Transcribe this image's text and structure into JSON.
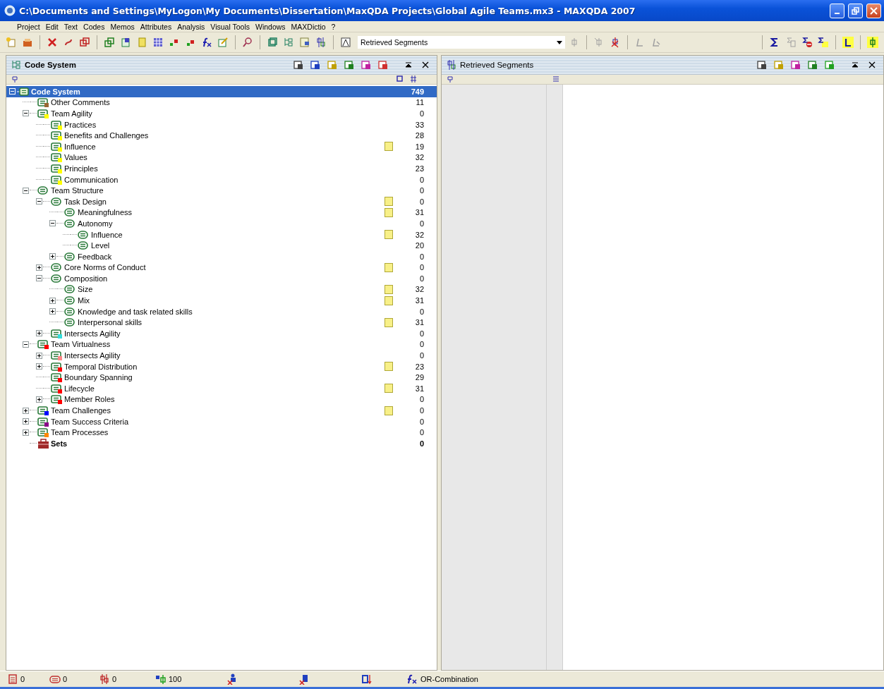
{
  "window": {
    "title": "C:\\Documents and Settings\\MyLogon\\My Documents\\Dissertation\\MaxQDA Projects\\Global Agile Teams.mx3 - MAXQDA 2007"
  },
  "menu": [
    "Project",
    "Edit",
    "Text",
    "Codes",
    "Memos",
    "Attributes",
    "Analysis",
    "Visual Tools",
    "Windows",
    "MAXDictio",
    "?"
  ],
  "toolbar": {
    "combo_value": "Retrieved Segments"
  },
  "code_panel": {
    "title": "Code System",
    "root": {
      "label": "Code System",
      "count": "749",
      "selected": true,
      "kind": "branch",
      "expanded": true
    },
    "codes": [
      {
        "label": "Other Comments",
        "count": "11",
        "memo": false,
        "kind": "leaf",
        "color": "#996633"
      },
      {
        "label": "Team Agility",
        "count": "0",
        "memo": false,
        "kind": "branch",
        "expanded": true,
        "color": "#ffff00",
        "children": [
          {
            "label": "Practices",
            "count": "33",
            "memo": false,
            "kind": "leaf",
            "color": "#ffff00"
          },
          {
            "label": "Benefits and Challenges",
            "count": "28",
            "memo": false,
            "kind": "leaf",
            "color": "#ffff00"
          },
          {
            "label": "Influence",
            "count": "19",
            "memo": true,
            "kind": "leaf",
            "color": "#ffff00"
          },
          {
            "label": "Values",
            "count": "32",
            "memo": false,
            "kind": "leaf",
            "color": "#ffff00"
          },
          {
            "label": "Principles",
            "count": "23",
            "memo": false,
            "kind": "leaf",
            "color": "#ffff00"
          },
          {
            "label": "Communication",
            "count": "0",
            "memo": false,
            "kind": "leaf",
            "color": "#ffff00"
          }
        ]
      },
      {
        "label": "Team Structure",
        "count": "0",
        "memo": false,
        "kind": "branch",
        "expanded": true,
        "children": [
          {
            "label": "Task Design",
            "count": "0",
            "memo": true,
            "kind": "branch",
            "expanded": true,
            "children": [
              {
                "label": "Meaningfulness",
                "count": "31",
                "memo": true,
                "kind": "leaf"
              },
              {
                "label": "Autonomy",
                "count": "0",
                "memo": false,
                "kind": "branch",
                "expanded": true,
                "children": [
                  {
                    "label": "Influence",
                    "count": "32",
                    "memo": true,
                    "kind": "leaf"
                  },
                  {
                    "label": "Level",
                    "count": "20",
                    "memo": false,
                    "kind": "leaf"
                  }
                ]
              },
              {
                "label": "Feedback",
                "count": "0",
                "memo": false,
                "kind": "branch",
                "expanded": false
              }
            ]
          },
          {
            "label": "Core Norms of Conduct",
            "count": "0",
            "memo": true,
            "kind": "branch",
            "expanded": false
          },
          {
            "label": "Composition",
            "count": "0",
            "memo": false,
            "kind": "branch",
            "expanded": true,
            "children": [
              {
                "label": "Size",
                "count": "32",
                "memo": true,
                "kind": "leaf"
              },
              {
                "label": "Mix",
                "count": "31",
                "memo": true,
                "kind": "branch",
                "expanded": false
              },
              {
                "label": "Knowledge and task related skills",
                "count": "0",
                "memo": false,
                "kind": "branch",
                "expanded": false
              },
              {
                "label": "Interpersonal skills",
                "count": "31",
                "memo": true,
                "kind": "leaf"
              }
            ]
          },
          {
            "label": "Intersects Agility",
            "count": "0",
            "memo": false,
            "kind": "branch",
            "expanded": false,
            "color": "#33dddd"
          }
        ]
      },
      {
        "label": "Team Virtualness",
        "count": "0",
        "memo": false,
        "kind": "branch",
        "expanded": true,
        "color": "#ff0000",
        "children": [
          {
            "label": "Intersects Agility",
            "count": "0",
            "memo": false,
            "kind": "branch",
            "expanded": false,
            "color": "#ff8888"
          },
          {
            "label": "Temporal Distribution",
            "count": "23",
            "memo": true,
            "kind": "branch",
            "expanded": false,
            "color": "#ff0000"
          },
          {
            "label": "Boundary Spanning",
            "count": "29",
            "memo": false,
            "kind": "leaf",
            "color": "#ff0000"
          },
          {
            "label": "Lifecycle",
            "count": "31",
            "memo": true,
            "kind": "leaf",
            "color": "#ff0000"
          },
          {
            "label": "Member Roles",
            "count": "0",
            "memo": false,
            "kind": "branch",
            "expanded": false,
            "color": "#ff0000"
          }
        ]
      },
      {
        "label": "Team Challenges",
        "count": "0",
        "memo": true,
        "kind": "branch",
        "expanded": false,
        "color": "#0000ff"
      },
      {
        "label": "Team Success Criteria",
        "count": "0",
        "memo": false,
        "kind": "branch",
        "expanded": false,
        "color": "#880088"
      },
      {
        "label": "Team Processes",
        "count": "0",
        "memo": false,
        "kind": "branch",
        "expanded": false,
        "color": "#ff8800"
      }
    ],
    "sets": {
      "label": "Sets",
      "count": "0"
    }
  },
  "segments_panel": {
    "title": "Retrieved Segments"
  },
  "status_bar": {
    "counts": [
      "0",
      "0",
      "0",
      "100"
    ],
    "mode": "OR-Combination"
  }
}
